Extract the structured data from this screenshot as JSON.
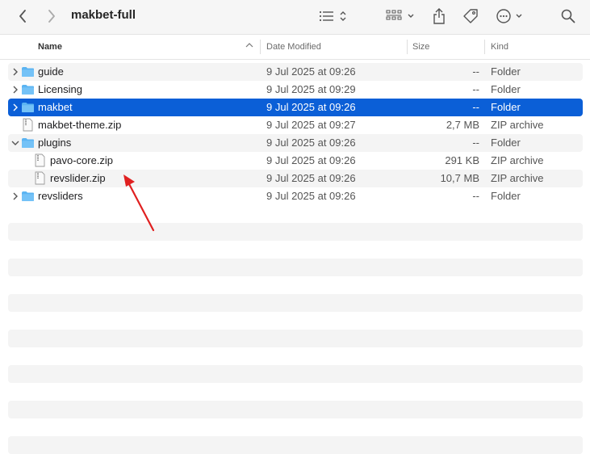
{
  "window": {
    "title": "makbet-full"
  },
  "toolbar": {
    "back_icon": "chevron-left-icon",
    "forward_icon": "chevron-right-icon",
    "view_icon": "list-view-icon",
    "group_icon": "grid-group-icon",
    "share_icon": "share-icon",
    "tag_icon": "tag-icon",
    "more_icon": "ellipsis-circle-icon",
    "search_icon": "search-icon"
  },
  "columns": {
    "name": "Name",
    "date": "Date Modified",
    "size": "Size",
    "kind": "Kind"
  },
  "files": [
    {
      "name": "guide",
      "date": "9 Jul 2025 at 09:26",
      "size": "--",
      "kind": "Folder"
    },
    {
      "name": "Licensing",
      "date": "9 Jul 2025 at 09:29",
      "size": "--",
      "kind": "Folder"
    },
    {
      "name": "makbet",
      "date": "9 Jul 2025 at 09:26",
      "size": "--",
      "kind": "Folder"
    },
    {
      "name": "makbet-theme.zip",
      "date": "9 Jul 2025 at 09:27",
      "size": "2,7 MB",
      "kind": "ZIP archive"
    },
    {
      "name": "plugins",
      "date": "9 Jul 2025 at 09:26",
      "size": "--",
      "kind": "Folder"
    },
    {
      "name": "pavo-core.zip",
      "date": "9 Jul 2025 at 09:26",
      "size": "291 KB",
      "kind": "ZIP archive"
    },
    {
      "name": "revslider.zip",
      "date": "9 Jul 2025 at 09:26",
      "size": "10,7 MB",
      "kind": "ZIP archive"
    },
    {
      "name": "revsliders",
      "date": "9 Jul 2025 at 09:26",
      "size": "--",
      "kind": "Folder"
    }
  ],
  "colors": {
    "selection": "#0b5fd7",
    "folder": "#5bb4f2",
    "annotation_arrow": "#e02020"
  }
}
